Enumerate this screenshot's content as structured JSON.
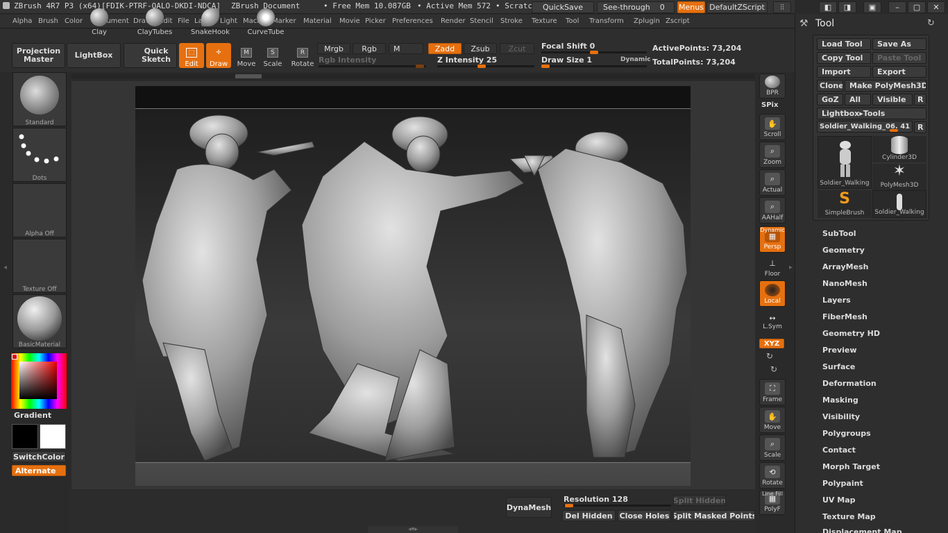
{
  "titlebar": {
    "app_title": "ZBrush 4R7 P3 (x64)[FDIK-PTRF-QALO-DKDI-NDCA]",
    "document": "ZBrush Document",
    "free_mem": "• Free Mem 10.087GB",
    "active_mem": "• Active Mem 572",
    "scratch": "• Scratc",
    "quicksave": "QuickSave",
    "see_through": "See-through",
    "see_through_value": "0",
    "menus": "Menus",
    "default_zscript": "DefaultZScript"
  },
  "menubar": [
    "Alpha",
    "Brush",
    "Color",
    "Document",
    "Draw",
    "Edit",
    "File",
    "Layer",
    "Light",
    "Macro",
    "Marker",
    "Material",
    "Movie",
    "Picker",
    "Preferences",
    "Render",
    "Stencil",
    "Stroke",
    "Texture",
    "Tool",
    "Transform",
    "Zplugin",
    "Zscript"
  ],
  "toolbar": {
    "projection_master": "Projection Master",
    "lightbox": "LightBox",
    "quick_sketch": "Quick Sketch",
    "edit": "Edit",
    "draw": "Draw",
    "move": "Move",
    "scale": "Scale",
    "rotate": "Rotate",
    "mrgb": "Mrgb",
    "rgb": "Rgb",
    "m": "M",
    "zadd": "Zadd",
    "zsub": "Zsub",
    "zcut": "Zcut",
    "rgb_intensity": "Rgb Intensity",
    "z_intensity": "Z Intensity 25",
    "focal_shift": "Focal Shift 0",
    "draw_size": "Draw Size 1",
    "dynamic": "Dynamic",
    "active_points": "ActivePoints: 73,204",
    "total_points": "TotalPoints: 73,204"
  },
  "left": {
    "brush_label": "Standard",
    "stroke_label": "Dots",
    "alpha_label": "Alpha Off",
    "texture_label": "Texture Off",
    "material_label": "BasicMaterial",
    "gradient": "Gradient",
    "switch_color": "SwitchColor",
    "alternate": "Alternate"
  },
  "shelf": {
    "bpr": "BPR",
    "spix": "SPix",
    "scroll": "Scroll",
    "zoom": "Zoom",
    "actual": "Actual",
    "aahalf": "AAHalf",
    "dynamic": "Dynamic",
    "persp": "Persp",
    "floor": "Floor",
    "local": "Local",
    "lsym": "L.Sym",
    "xyz": "XYZ",
    "frame": "Frame",
    "move": "Move",
    "scale": "Scale",
    "rotate": "Rotate",
    "line_fill": "Line Fill",
    "polyf": "PolyF"
  },
  "tool_panel": {
    "title": "Tool",
    "load_tool": "Load Tool",
    "save_as": "Save As",
    "copy_tool": "Copy Tool",
    "paste_tool": "Paste Tool",
    "import": "Import",
    "export": "Export",
    "clone": "Clone",
    "make_polymesh": "Make PolyMesh3D",
    "goz": "GoZ",
    "all": "All",
    "visible": "Visible",
    "r": "R",
    "lightbox_tools": "Lightbox▸Tools",
    "current_tool": "Soldier_Walking_06. 41",
    "thumbs": [
      "Soldier_Walking",
      "Cylinder3D",
      "PolyMesh3D",
      "SimpleBrush",
      "Soldier_Walking"
    ],
    "sections": [
      "SubTool",
      "Geometry",
      "ArrayMesh",
      "NanoMesh",
      "Layers",
      "FiberMesh",
      "Geometry HD",
      "Preview",
      "Surface",
      "Deformation",
      "Masking",
      "Visibility",
      "Polygroups",
      "Contact",
      "Morph Target",
      "Polypaint",
      "UV Map",
      "Texture Map",
      "Displacement Map"
    ]
  },
  "bottom": {
    "brushes": [
      "Clay",
      "ClayTubes",
      "SnakeHook",
      "CurveTube"
    ],
    "dynamesh": "DynaMesh",
    "resolution": "Resolution 128",
    "split_hidden": "Split Hidden",
    "del_hidden": "Del Hidden",
    "close_holes": "Close Holes",
    "split_masked": "Split Masked Points"
  },
  "colors": {
    "accent": "#e6700f",
    "primary_swatch": "#000000",
    "secondary_swatch": "#ffffff"
  }
}
